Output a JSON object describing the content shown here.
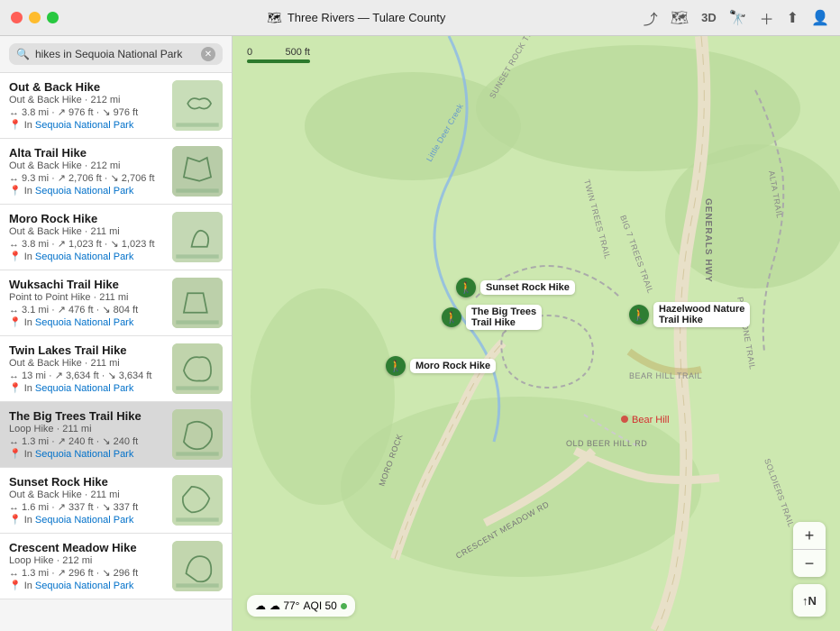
{
  "titleBar": {
    "title": "Three Rivers — Tulare County",
    "documentIcon": "📄"
  },
  "toolbar": {
    "locationIcon": "⤴",
    "mapIcon": "🗺",
    "threeDLabel": "3D",
    "binocularsIcon": "🔭",
    "smileyIcon": "😊",
    "plusIcon": "+",
    "shareIcon": "⬆",
    "profileIcon": "👤"
  },
  "search": {
    "placeholder": "hikes in Sequoia National Park",
    "clearLabel": "✕"
  },
  "results": [
    {
      "id": "r0",
      "title": "Out & Back Hike",
      "subtitle": "Out & Back Hike · 212 mi",
      "detail": "↔ 3.8 mi · ↗ 976 ft · ↘ 976 ft",
      "location": "In Sequoia National Park",
      "selected": false
    },
    {
      "id": "r1",
      "title": "Alta Trail Hike",
      "subtitle": "Out & Back Hike · 212 mi",
      "detail": "↔ 9.3 mi · ↗ 2,706 ft · ↘ 2,706 ft",
      "location": "In Sequoia National Park",
      "selected": false
    },
    {
      "id": "r2",
      "title": "Moro Rock Hike",
      "subtitle": "Out & Back Hike · 211 mi",
      "detail": "↔ 3.8 mi · ↗ 1,023 ft · ↘ 1,023 ft",
      "location": "In Sequoia National Park",
      "selected": false
    },
    {
      "id": "r3",
      "title": "Wuksachi Trail Hike",
      "subtitle": "Point to Point Hike · 211 mi",
      "detail": "↔ 3.1 mi · ↗ 476 ft · ↘ 804 ft",
      "location": "In Sequoia National Park",
      "selected": false
    },
    {
      "id": "r4",
      "title": "Twin Lakes Trail Hike",
      "subtitle": "Out & Back Hike · 211 mi",
      "detail": "↔ 13 mi · ↗ 3,634 ft · ↘ 3,634 ft",
      "location": "In Sequoia National Park",
      "selected": false
    },
    {
      "id": "r5",
      "title": "The Big Trees Trail Hike",
      "subtitle": "Loop Hike · 211 mi",
      "detail": "↔ 1.3 mi · ↗ 240 ft · ↘ 240 ft",
      "location": "In Sequoia National Park",
      "selected": true
    },
    {
      "id": "r6",
      "title": "Sunset Rock Hike",
      "subtitle": "Out & Back Hike · 211 mi",
      "detail": "↔ 1.6 mi · ↗ 337 ft · ↘ 337 ft",
      "location": "In Sequoia National Park",
      "selected": false
    },
    {
      "id": "r7",
      "title": "Crescent Meadow Hike",
      "subtitle": "Loop Hike · 212 mi",
      "detail": "↔ 1.3 mi · ↗ 296 ft · ↘ 296 ft",
      "location": "In Sequoia National Park",
      "selected": false
    }
  ],
  "map": {
    "scaleStart": "0",
    "scaleEnd": "500 ft",
    "weather": "☁ 77°",
    "aqi": "AQI 50",
    "compass": "N",
    "zoomPlus": "+",
    "zoomMinus": "−",
    "markers": [
      {
        "id": "m1",
        "label": "Sunset Rock Hike",
        "top": "300",
        "left": "248"
      },
      {
        "id": "m2",
        "label": "The Big Trees Trail Hike",
        "top": "333",
        "left": "235"
      },
      {
        "id": "m3",
        "label": "Hazelwood Nature Trail Hike",
        "top": "330",
        "left": "440"
      },
      {
        "id": "m4",
        "label": "Moro Rock Hike",
        "top": "390",
        "left": "180"
      }
    ],
    "labels": [
      {
        "id": "l1",
        "text": "GENERALS HWY",
        "top": "200",
        "left": "550",
        "rotate": "90"
      },
      {
        "id": "l2",
        "text": "Bear Hill",
        "top": "450",
        "left": "430"
      }
    ]
  }
}
